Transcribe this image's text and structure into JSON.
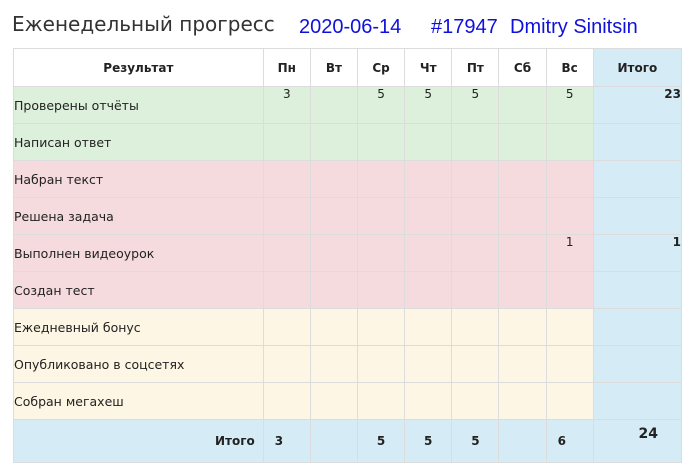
{
  "header": {
    "title": "Еженедельный прогресс",
    "date": "2020-06-14",
    "user_id": "#17947",
    "user_name": "Dmitry Sinitsin"
  },
  "colors": {
    "green_row": "#dcf0dc",
    "red_row": "#f5dbdd",
    "yellow_row": "#fdf6e4",
    "total_column": "#d5ecf6",
    "meta_text": "#1010dd"
  },
  "table": {
    "columns": [
      "Результат",
      "Пн",
      "Вт",
      "Ср",
      "Чт",
      "Пт",
      "Сб",
      "Вс",
      "Итого"
    ],
    "rows": [
      {
        "label": "Проверены отчёты",
        "group": "green",
        "days": [
          "3",
          "",
          "5",
          "5",
          "5",
          "",
          "5"
        ],
        "total": "23"
      },
      {
        "label": "Написан ответ",
        "group": "green",
        "days": [
          "",
          "",
          "",
          "",
          "",
          "",
          ""
        ],
        "total": ""
      },
      {
        "label": "Набран текст",
        "group": "red",
        "days": [
          "",
          "",
          "",
          "",
          "",
          "",
          ""
        ],
        "total": ""
      },
      {
        "label": "Решена задача",
        "group": "red",
        "days": [
          "",
          "",
          "",
          "",
          "",
          "",
          ""
        ],
        "total": ""
      },
      {
        "label": "Выполнен видеоурок",
        "group": "red",
        "days": [
          "",
          "",
          "",
          "",
          "",
          "",
          "1"
        ],
        "total": "1"
      },
      {
        "label": "Создан тест",
        "group": "red",
        "days": [
          "",
          "",
          "",
          "",
          "",
          "",
          ""
        ],
        "total": ""
      },
      {
        "label": "Ежедневный бонус",
        "group": "yellow",
        "days": [
          "",
          "",
          "",
          "",
          "",
          "",
          ""
        ],
        "total": ""
      },
      {
        "label": "Опубликовано в соцсетях",
        "group": "yellow",
        "days": [
          "",
          "",
          "",
          "",
          "",
          "",
          ""
        ],
        "total": ""
      },
      {
        "label": "Собран мегахеш",
        "group": "yellow",
        "days": [
          "",
          "",
          "",
          "",
          "",
          "",
          ""
        ],
        "total": ""
      }
    ],
    "footer": {
      "label": "Итого",
      "days": [
        "3",
        "",
        "5",
        "5",
        "5",
        "",
        "6"
      ],
      "total": "24"
    }
  }
}
